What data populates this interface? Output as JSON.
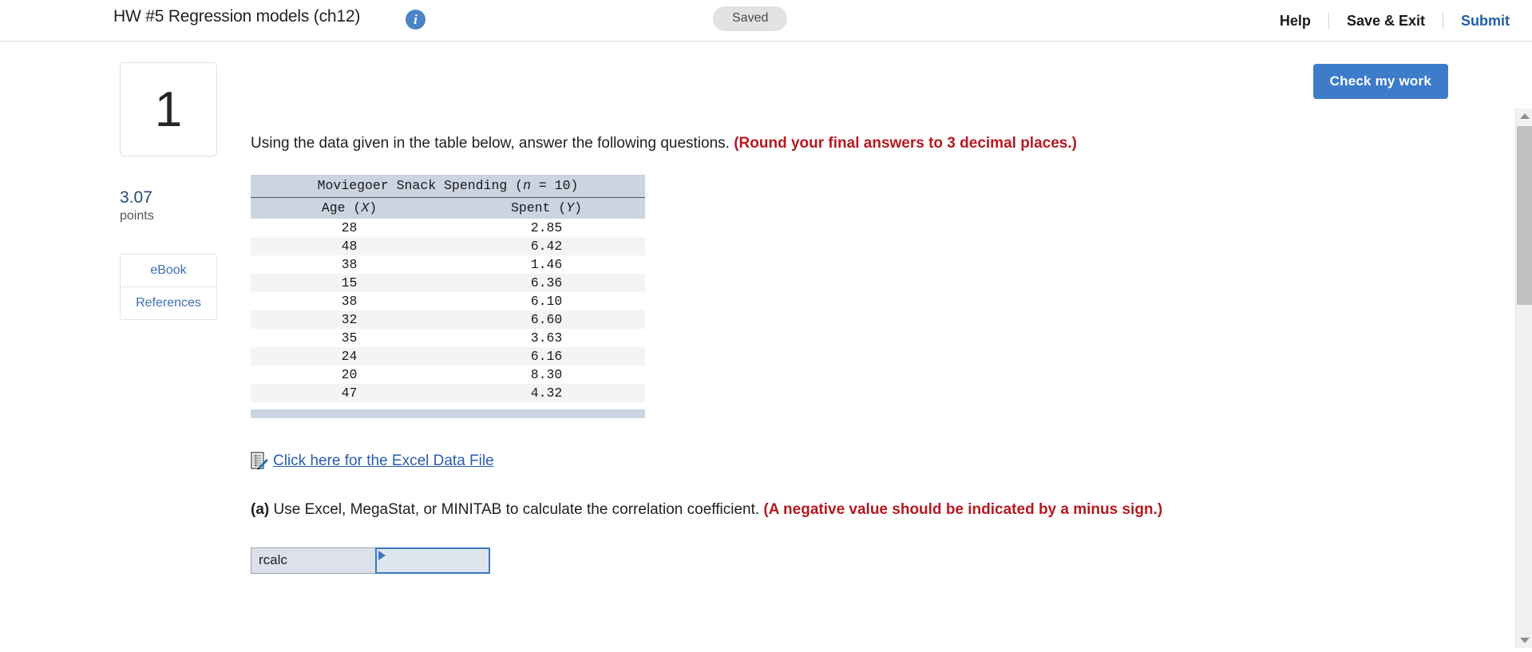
{
  "header": {
    "title": "HW #5 Regression models (ch12)",
    "info_icon": "info-icon",
    "status_badge": "Saved",
    "help_label": "Help",
    "save_exit_label": "Save & Exit",
    "submit_label": "Submit"
  },
  "toolbar": {
    "check_my_work_label": "Check my work"
  },
  "rail": {
    "question_number": "1",
    "points_value": "3.07",
    "points_label": "points",
    "ebook_label": "eBook",
    "references_label": "References"
  },
  "question": {
    "stem": "Using the data given in the table below, answer the following questions.",
    "stem_hint": "(Round your final answers to 3 decimal places.)",
    "part_a_marker": "(a)",
    "part_a_text": "Use Excel, MegaStat, or MINITAB to calculate the correlation coefficient.",
    "part_a_hint": "(A negative value should be indicated by a minus sign.)",
    "excel_link_label": "Click here for the Excel Data File",
    "excel_icon": "excel-file-icon"
  },
  "table": {
    "title_prefix": "Moviegoer Snack Spending (",
    "title_var": "n",
    "title_suffix": " = 10)",
    "title_full": "Moviegoer Snack Spending (n = 10)",
    "col_x_prefix": "Age (",
    "col_x_var": "X",
    "col_x_suffix": ")",
    "col_y_prefix": "Spent (",
    "col_y_var": "Y",
    "col_y_suffix": ")",
    "columns": [
      "Age (X)",
      "Spent (Y)"
    ],
    "rows": [
      [
        "28",
        "2.85"
      ],
      [
        "48",
        "6.42"
      ],
      [
        "38",
        "1.46"
      ],
      [
        "15",
        "6.36"
      ],
      [
        "38",
        "6.10"
      ],
      [
        "32",
        "6.60"
      ],
      [
        "35",
        "3.63"
      ],
      [
        "24",
        "6.16"
      ],
      [
        "20",
        "8.30"
      ],
      [
        "47",
        "4.32"
      ]
    ]
  },
  "answer": {
    "label": "rcalc",
    "value": "",
    "placeholder": ""
  },
  "scrollbar": {
    "up_icon": "chevron-up-icon",
    "down_icon": "chevron-down-icon"
  },
  "colors": {
    "accent_blue": "#3d7cc9",
    "link_blue": "#2a5db0",
    "hint_red": "#b51921",
    "table_header": "#ccd4e2",
    "saved_bg": "#e2e2e4"
  }
}
